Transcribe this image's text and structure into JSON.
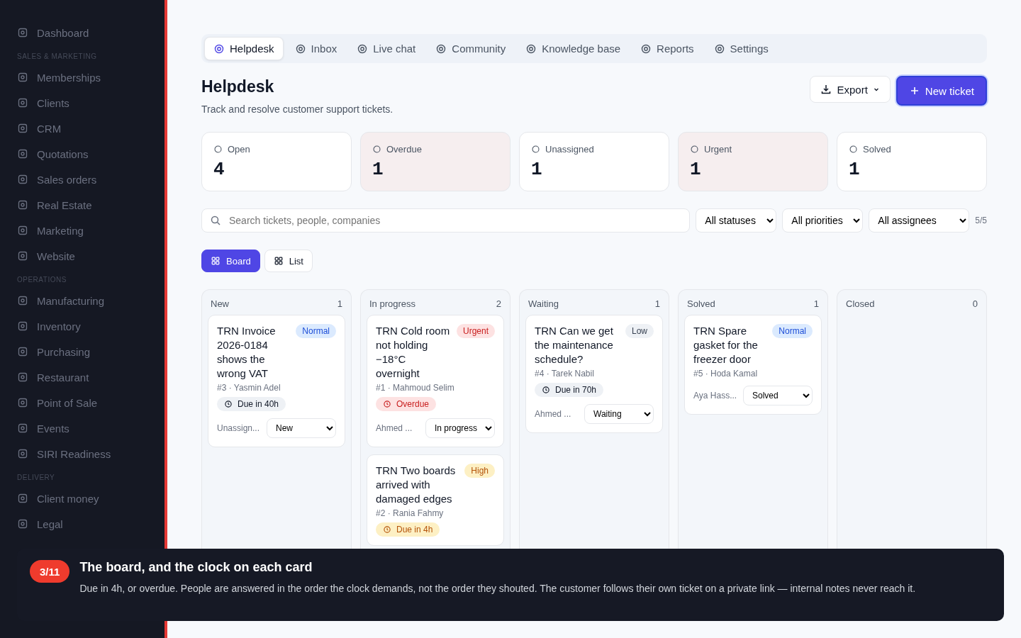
{
  "sidebar": {
    "items": [
      {
        "kind": "item",
        "label": "Dashboard"
      },
      {
        "kind": "section",
        "label": "SALES & MARKETING"
      },
      {
        "kind": "item",
        "label": "Memberships"
      },
      {
        "kind": "item",
        "label": "Clients"
      },
      {
        "kind": "item",
        "label": "CRM"
      },
      {
        "kind": "item",
        "label": "Quotations"
      },
      {
        "kind": "item",
        "label": "Sales orders"
      },
      {
        "kind": "item",
        "label": "Real Estate"
      },
      {
        "kind": "item",
        "label": "Marketing"
      },
      {
        "kind": "item",
        "label": "Website"
      },
      {
        "kind": "section",
        "label": "OPERATIONS"
      },
      {
        "kind": "item",
        "label": "Manufacturing"
      },
      {
        "kind": "item",
        "label": "Inventory"
      },
      {
        "kind": "item",
        "label": "Purchasing"
      },
      {
        "kind": "item",
        "label": "Restaurant"
      },
      {
        "kind": "item",
        "label": "Point of Sale"
      },
      {
        "kind": "item",
        "label": "Events"
      },
      {
        "kind": "item",
        "label": "SIRI Readiness"
      },
      {
        "kind": "section",
        "label": "DELIVERY"
      },
      {
        "kind": "item",
        "label": "Client money"
      },
      {
        "kind": "item",
        "label": "Legal"
      }
    ]
  },
  "tabs": [
    {
      "label": "Helpdesk",
      "selected": true
    },
    {
      "label": "Inbox",
      "selected": false
    },
    {
      "label": "Live chat",
      "selected": false
    },
    {
      "label": "Community",
      "selected": false
    },
    {
      "label": "Knowledge base",
      "selected": false
    },
    {
      "label": "Reports",
      "selected": false
    },
    {
      "label": "Settings",
      "selected": false
    }
  ],
  "header": {
    "title": "Helpdesk",
    "subtitle": "Track and resolve customer support tickets.",
    "export_button": "Export",
    "new_button": "New ticket"
  },
  "stats": [
    {
      "label": "Open",
      "value": "4",
      "alert": false
    },
    {
      "label": "Overdue",
      "value": "1",
      "alert": true
    },
    {
      "label": "Unassigned",
      "value": "1",
      "alert": false
    },
    {
      "label": "Urgent",
      "value": "1",
      "alert": true
    },
    {
      "label": "Solved",
      "value": "1",
      "alert": false
    }
  ],
  "filters": {
    "search_placeholder": "Search tickets, people, companies",
    "status": "All statuses",
    "priority": "All priorities",
    "assignee": "All assignees",
    "count": "5/5"
  },
  "views": [
    {
      "label": "Board",
      "selected": true
    },
    {
      "label": "List",
      "selected": false
    }
  ],
  "columns": [
    {
      "name": "New",
      "count": "1",
      "cards": [
        {
          "title": "TRN Invoice 2026-0184 shows the wrong VAT",
          "priority": {
            "label": "Normal",
            "kind": "normal"
          },
          "meta": "#3 · Yasmin Adel",
          "due": {
            "label": "Due in 40h",
            "kind": "due"
          },
          "assignee": "Unassign...",
          "status": "New"
        }
      ]
    },
    {
      "name": "In progress",
      "count": "2",
      "cards": [
        {
          "title": "TRN Cold room not holding −18°C overnight",
          "priority": {
            "label": "Urgent",
            "kind": "urgent"
          },
          "meta": "#1 · Mahmoud Selim",
          "due": {
            "label": "Overdue",
            "kind": "overdue"
          },
          "assignee": "Ahmed ...",
          "status": "In progress"
        },
        {
          "title": "TRN Two boards arrived with damaged edges",
          "priority": {
            "label": "High",
            "kind": "high"
          },
          "meta": "#2 · Rania Fahmy",
          "due": {
            "label": "Due in 4h",
            "kind": "soon"
          }
        }
      ]
    },
    {
      "name": "Waiting",
      "count": "1",
      "cards": [
        {
          "title": "TRN Can we get the maintenance schedule?",
          "priority": {
            "label": "Low",
            "kind": "low"
          },
          "meta": "#4 · Tarek Nabil",
          "due": {
            "label": "Due in 70h",
            "kind": "due"
          },
          "assignee": "Ahmed ...",
          "status": "Waiting"
        }
      ]
    },
    {
      "name": "Solved",
      "count": "1",
      "cards": [
        {
          "title": "TRN Spare gasket for the freezer door",
          "priority": {
            "label": "Normal",
            "kind": "normal"
          },
          "meta": "#5 · Hoda Kamal",
          "assignee": "Aya Hass...",
          "status": "Solved"
        }
      ]
    },
    {
      "name": "Closed",
      "count": "0"
    }
  ],
  "tour": {
    "step": "3/11",
    "title": "The board, and the clock on each card",
    "body": "Due in 4h, or overdue. People are answered in the order the clock demands, not the order they shouted. The customer follows their own ticket on a private link — internal notes never reach it."
  }
}
